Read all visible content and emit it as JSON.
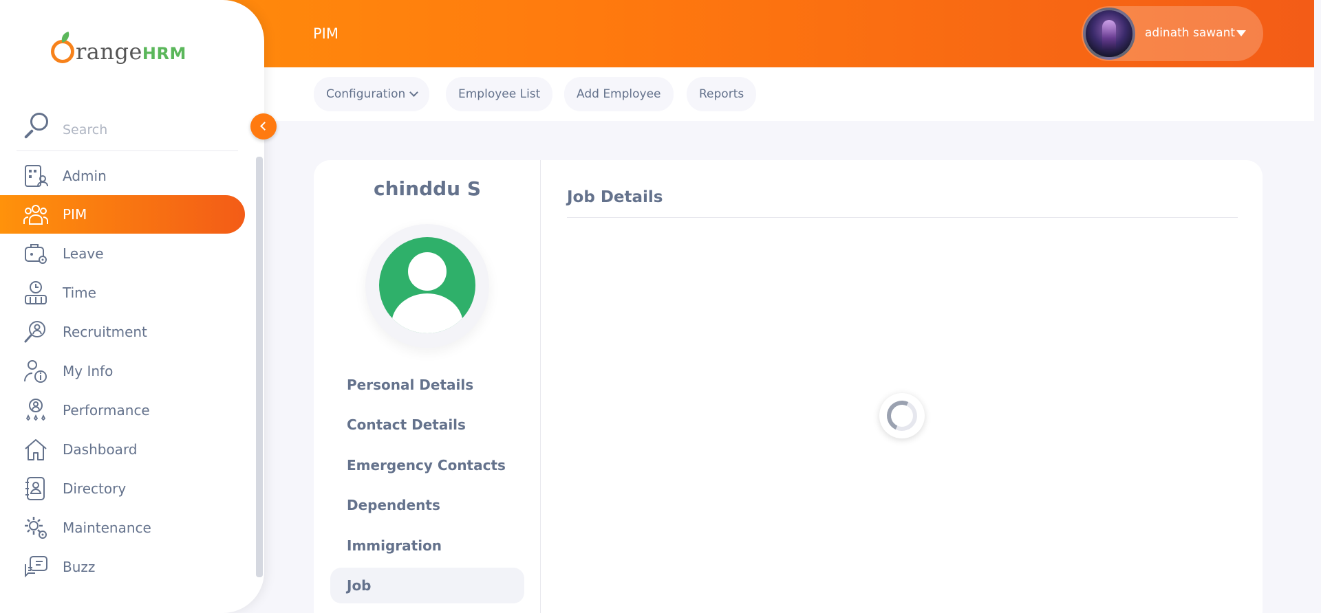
{
  "app": {
    "brand_text": "range",
    "brand_suffix": "HRM"
  },
  "header": {
    "module_title": "PIM",
    "user_name": "adinath sawant"
  },
  "subnav": {
    "configuration": "Configuration",
    "employee_list": "Employee List",
    "add_employee": "Add Employee",
    "reports": "Reports"
  },
  "sidebar": {
    "search_placeholder": "Search",
    "items": [
      {
        "label": "Admin",
        "icon": "admin-icon"
      },
      {
        "label": "PIM",
        "icon": "pim-icon",
        "active": true
      },
      {
        "label": "Leave",
        "icon": "leave-icon"
      },
      {
        "label": "Time",
        "icon": "time-icon"
      },
      {
        "label": "Recruitment",
        "icon": "recruitment-icon"
      },
      {
        "label": "My Info",
        "icon": "my-info-icon"
      },
      {
        "label": "Performance",
        "icon": "performance-icon"
      },
      {
        "label": "Dashboard",
        "icon": "dashboard-icon"
      },
      {
        "label": "Directory",
        "icon": "directory-icon"
      },
      {
        "label": "Maintenance",
        "icon": "maintenance-icon"
      },
      {
        "label": "Buzz",
        "icon": "buzz-icon"
      }
    ]
  },
  "profile": {
    "employee_name": "chinddu S",
    "tabs": [
      {
        "label": "Personal Details"
      },
      {
        "label": "Contact Details"
      },
      {
        "label": "Emergency Contacts"
      },
      {
        "label": "Dependents"
      },
      {
        "label": "Immigration"
      },
      {
        "label": "Job",
        "active": true
      }
    ]
  },
  "content": {
    "section_title": "Job Details"
  },
  "colors": {
    "accent": "#ff7a0e",
    "accent_end": "#f35c17",
    "text": "#64728c",
    "avatar_green": "#2fb06a"
  }
}
